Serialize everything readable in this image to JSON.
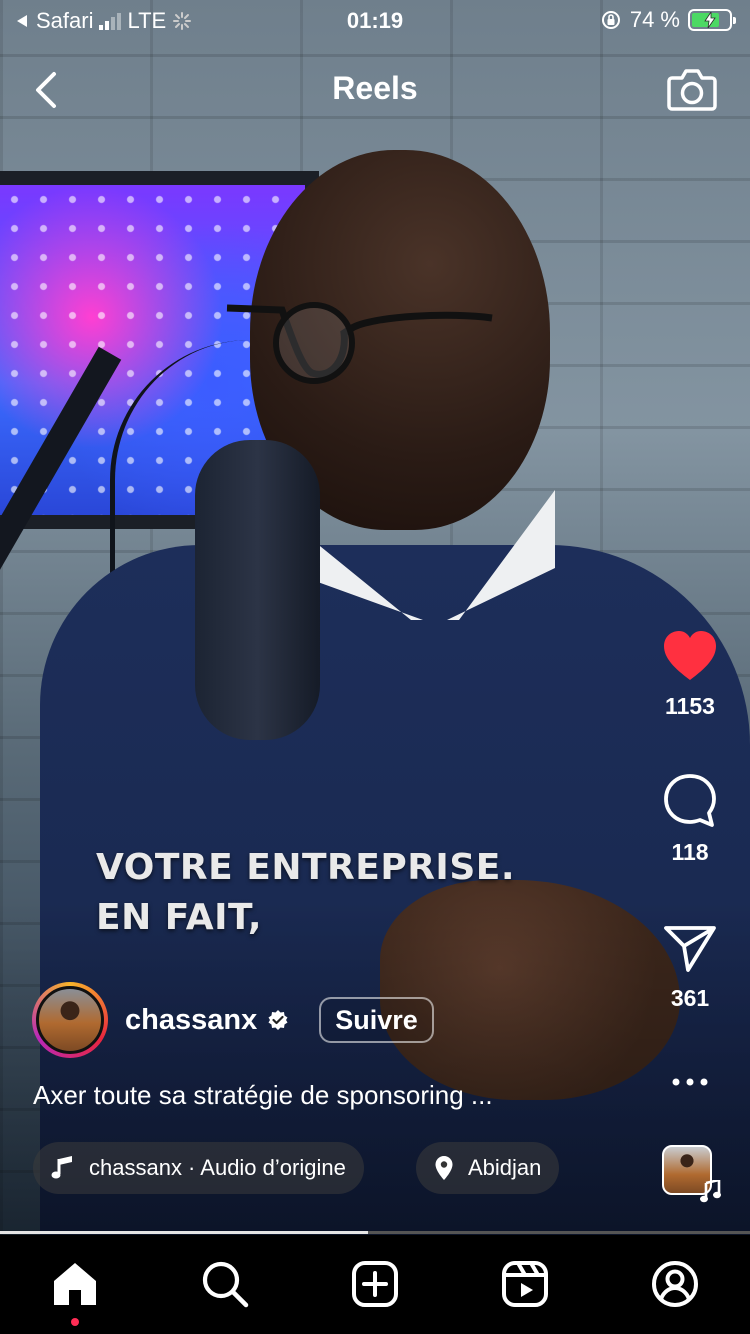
{
  "status_bar": {
    "carrier": "Safari",
    "network": "LTE",
    "time": "01:19",
    "battery_percent": "74 %",
    "battery_level": 0.74
  },
  "header": {
    "title": "Reels"
  },
  "video": {
    "overlay_line1": "VOTRE ENTREPRISE.",
    "overlay_line2": "EN FAIT,",
    "progress": 0.49
  },
  "actions": {
    "like_count": "1153",
    "comment_count": "118",
    "share_count": "361",
    "like_color": "#ff3040"
  },
  "author": {
    "username": "chassanx",
    "follow_label": "Suivre"
  },
  "caption": "Axer toute sa stratégie de sponsoring ...",
  "audio": {
    "label": "chassanx · Audio d’origine"
  },
  "location": {
    "label": "Abidjan"
  },
  "tabbar": {
    "items": [
      "home-icon",
      "search-icon",
      "create-icon",
      "reels-icon",
      "profile-icon"
    ],
    "active": "home-icon"
  }
}
